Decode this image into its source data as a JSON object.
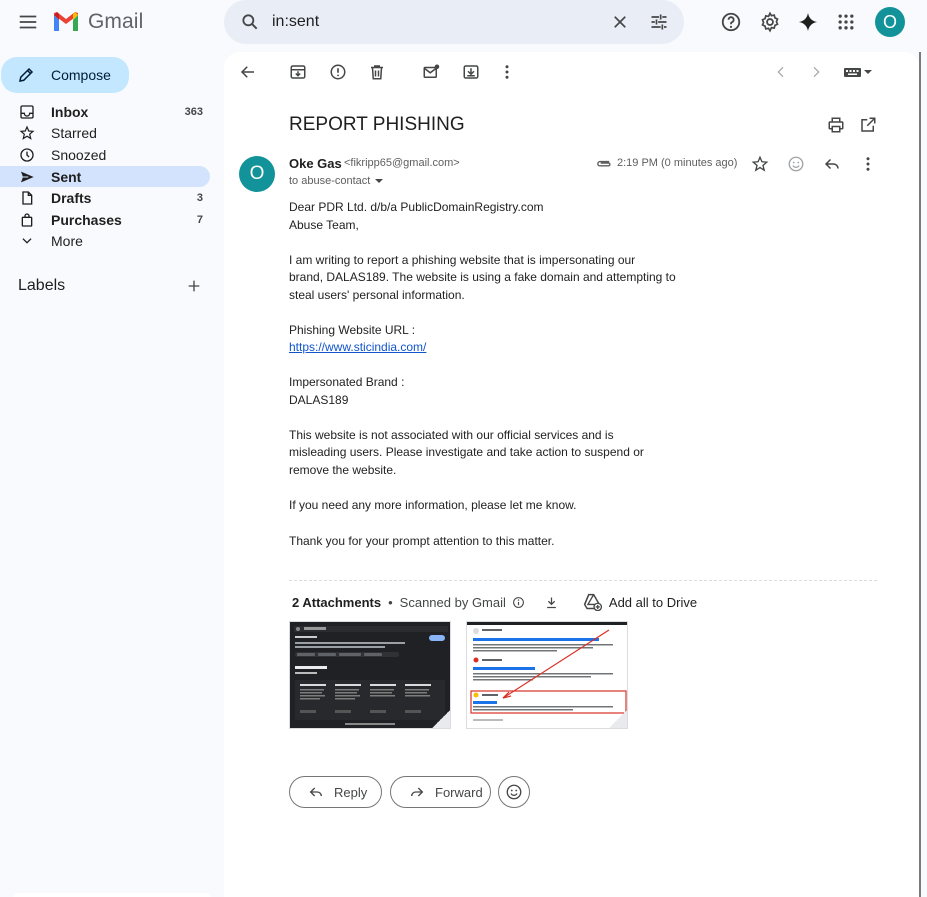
{
  "app": {
    "logo_text": "Gmail",
    "avatar_initial": "O"
  },
  "search": {
    "value": "in:sent"
  },
  "sidebar": {
    "compose_label": "Compose",
    "items": [
      {
        "label": "Inbox",
        "count": "363"
      },
      {
        "label": "Starred",
        "count": ""
      },
      {
        "label": "Snoozed",
        "count": ""
      },
      {
        "label": "Sent",
        "count": ""
      },
      {
        "label": "Drafts",
        "count": "3"
      },
      {
        "label": "Purchases",
        "count": "7"
      },
      {
        "label": "More",
        "count": ""
      }
    ],
    "labels_title": "Labels"
  },
  "email": {
    "subject": "REPORT PHISHING",
    "sender_initial": "O",
    "sender_name": "Oke Gas",
    "sender_email": "<fikripp65@gmail.com>",
    "recipient": "to abuse-contact",
    "time": "2:19 PM (0 minutes ago)",
    "body": {
      "greeting_1": "Dear PDR Ltd. d/b/a PublicDomainRegistry.com",
      "greeting_2": "Abuse Team,",
      "para1_line1": "I am writing to report a phishing website that is impersonating our",
      "para1_line2": "brand, DALAS189. The website is using a fake domain and attempting to",
      "para1_line3": "steal users' personal information.",
      "url_label": "Phishing Website URL :",
      "url": "https://www.sticindia.com/",
      "brand_label": "Impersonated Brand :",
      "brand": "DALAS189",
      "para2_line1": "This website is not associated with our official services and is",
      "para2_line2": "misleading users. Please investigate and take action to suspend or",
      "para2_line3": "remove the website.",
      "para3": "If you need any more information, please let me know.",
      "para4": "Thank you for your prompt attention to this matter."
    },
    "attachments": {
      "count_label": "2 Attachments",
      "separator": "•",
      "scan_label": "Scanned by Gmail",
      "add_drive_label": "Add all to Drive"
    },
    "actions": {
      "reply_label": "Reply",
      "forward_label": "Forward"
    }
  },
  "colors": {
    "accent": "#0b57d0",
    "compose_bg": "#c2e7ff",
    "active_nav_bg": "#d3e3fd",
    "avatar_bg": "#12939a",
    "link": "#1155cc"
  }
}
